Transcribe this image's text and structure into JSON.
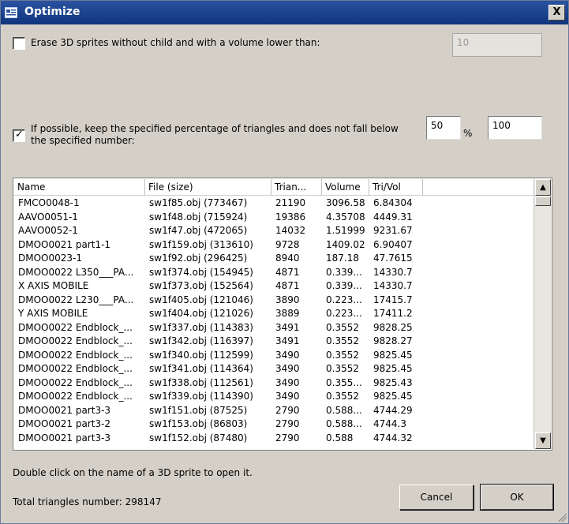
{
  "window": {
    "title": "Optimize",
    "close_label": "X"
  },
  "options": {
    "erase_label": "Erase 3D sprites without child and with a volume lower than:",
    "erase_checked": false,
    "erase_value": "10",
    "keep_label_line1": "If possible, keep the specified percentage of triangles and does not fall below",
    "keep_label_line2": "the specified number:",
    "keep_checked": true,
    "percent_value": "50",
    "percent_unit": "%",
    "min_value": "100"
  },
  "list": {
    "columns": [
      "Name",
      "File (size)",
      "Trian...",
      "Volume",
      "Tri/Vol"
    ],
    "rows": [
      [
        "FMCO0048-1",
        "sw1f85.obj (773467)",
        "21190",
        "3096.58",
        "6.84304"
      ],
      [
        "AAVO0051-1",
        "sw1f48.obj (715924)",
        "19386",
        "4.35708",
        "4449.31"
      ],
      [
        "AAVO0052-1",
        "sw1f47.obj (472065)",
        "14032",
        "1.51999",
        "9231.67"
      ],
      [
        "DMOO0021 part1-1",
        "sw1f159.obj (313610)",
        "9728",
        "1409.02",
        "6.90407"
      ],
      [
        "DMOO0023-1",
        "sw1f92.obj (296425)",
        "8940",
        "187.18",
        "47.7615"
      ],
      [
        "DMOO0022 L350___PA...",
        "sw1f374.obj (154945)",
        "4871",
        "0.339...",
        "14330.7"
      ],
      [
        "X AXIS MOBILE",
        "sw1f373.obj (152564)",
        "4871",
        "0.339...",
        "14330.7"
      ],
      [
        "DMOO0022 L230___PA...",
        "sw1f405.obj (121046)",
        "3890",
        "0.223...",
        "17415.7"
      ],
      [
        "Y AXIS MOBILE",
        "sw1f404.obj (121026)",
        "3889",
        "0.223...",
        "17411.2"
      ],
      [
        "DMOO0022 Endblock_...",
        "sw1f337.obj (114383)",
        "3491",
        "0.3552",
        "9828.25"
      ],
      [
        "DMOO0022 Endblock_...",
        "sw1f342.obj (116397)",
        "3491",
        "0.3552",
        "9828.27"
      ],
      [
        "DMOO0022 Endblock_...",
        "sw1f340.obj (112599)",
        "3490",
        "0.3552",
        "9825.45"
      ],
      [
        "DMOO0022 Endblock_...",
        "sw1f341.obj (114364)",
        "3490",
        "0.3552",
        "9825.45"
      ],
      [
        "DMOO0022 Endblock_...",
        "sw1f338.obj (112561)",
        "3490",
        "0.355...",
        "9825.43"
      ],
      [
        "DMOO0022 Endblock_...",
        "sw1f339.obj (114390)",
        "3490",
        "0.3552",
        "9825.45"
      ],
      [
        "DMOO0021 part3-3",
        "sw1f151.obj (87525)",
        "2790",
        "0.588...",
        "4744.29"
      ],
      [
        "DMOO0021 part3-2",
        "sw1f153.obj (86803)",
        "2790",
        "0.588...",
        "4744.3"
      ],
      [
        "DMOO0021 part3-3",
        "sw1f152.obj (87480)",
        "2790",
        "0.588",
        "4744.32"
      ]
    ]
  },
  "footer": {
    "hint": "Double click on the name of a 3D sprite to open it.",
    "total_label": "Total triangles number: 298147",
    "cancel_label": "Cancel",
    "ok_label": "OK"
  }
}
